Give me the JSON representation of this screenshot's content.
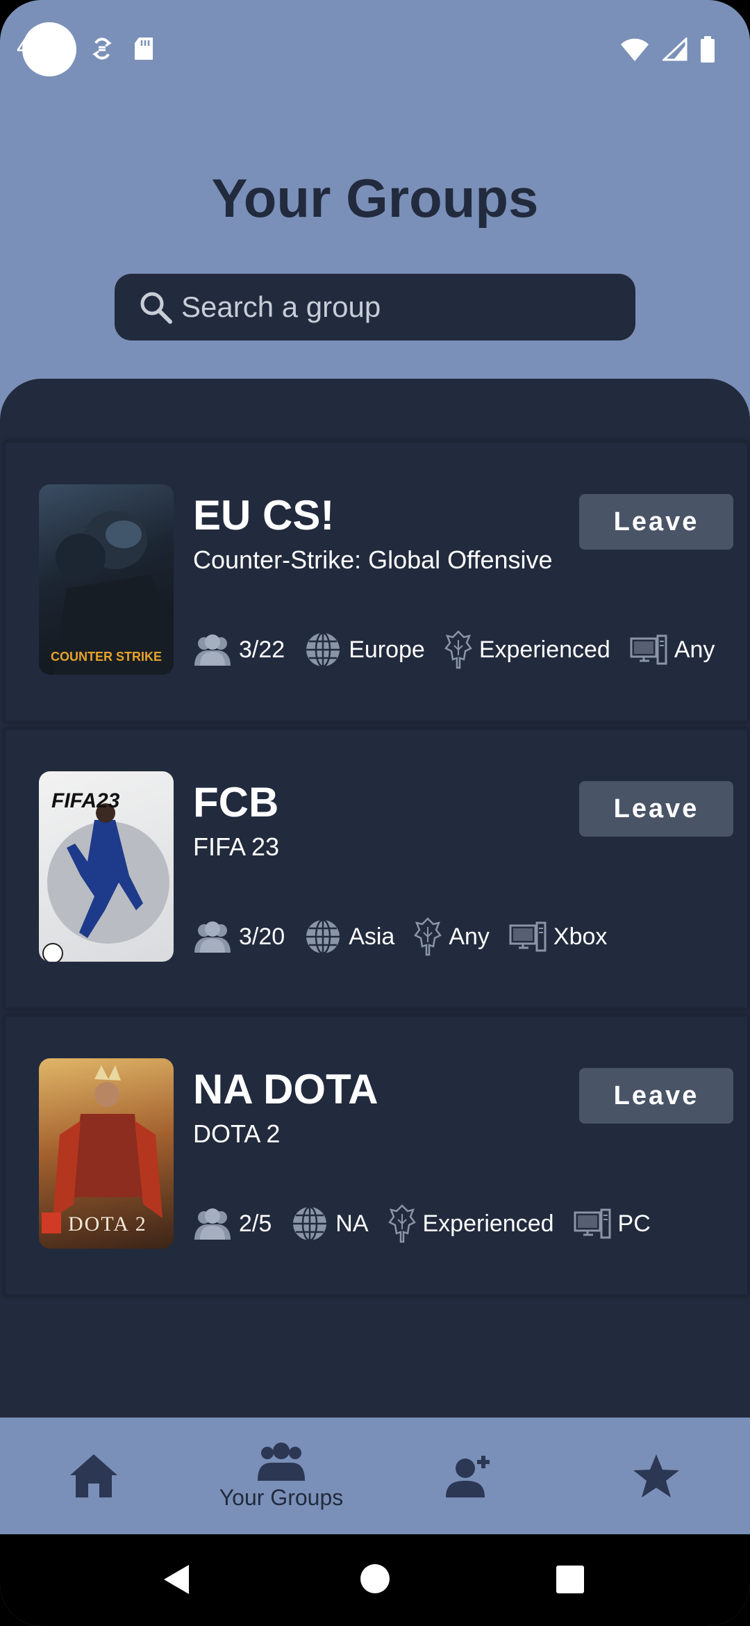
{
  "status_bar": {
    "time": "4"
  },
  "page": {
    "title": "Your Groups"
  },
  "search": {
    "placeholder": "Search a group"
  },
  "groups": [
    {
      "name": "EU CS!",
      "game": "Counter-Strike: Global Offensive",
      "cover_text": "COUNTER STRIKE",
      "leave_label": "Leave",
      "members": "3/22",
      "region": "Europe",
      "skill": "Experienced",
      "platform": "Any"
    },
    {
      "name": "FCB",
      "game": "FIFA 23",
      "cover_text": "FIFA23",
      "leave_label": "Leave",
      "members": "3/20",
      "region": "Asia",
      "skill": "Any",
      "platform": "Xbox"
    },
    {
      "name": "NA DOTA",
      "game": "DOTA 2",
      "cover_text": "DOTA 2",
      "leave_label": "Leave",
      "members": "2/5",
      "region": "NA",
      "skill": "Experienced",
      "platform": "PC"
    }
  ],
  "bottom_nav": {
    "items": [
      {
        "icon": "home-icon",
        "label": ""
      },
      {
        "icon": "groups-icon",
        "label": "Your Groups",
        "active": true
      },
      {
        "icon": "add-user-icon",
        "label": ""
      },
      {
        "icon": "star-icon",
        "label": ""
      }
    ]
  },
  "colors": {
    "header_bg": "#7a90b8",
    "panel_bg": "#222a3d",
    "button_bg": "#4a5467",
    "text_dark": "#222a3d"
  }
}
